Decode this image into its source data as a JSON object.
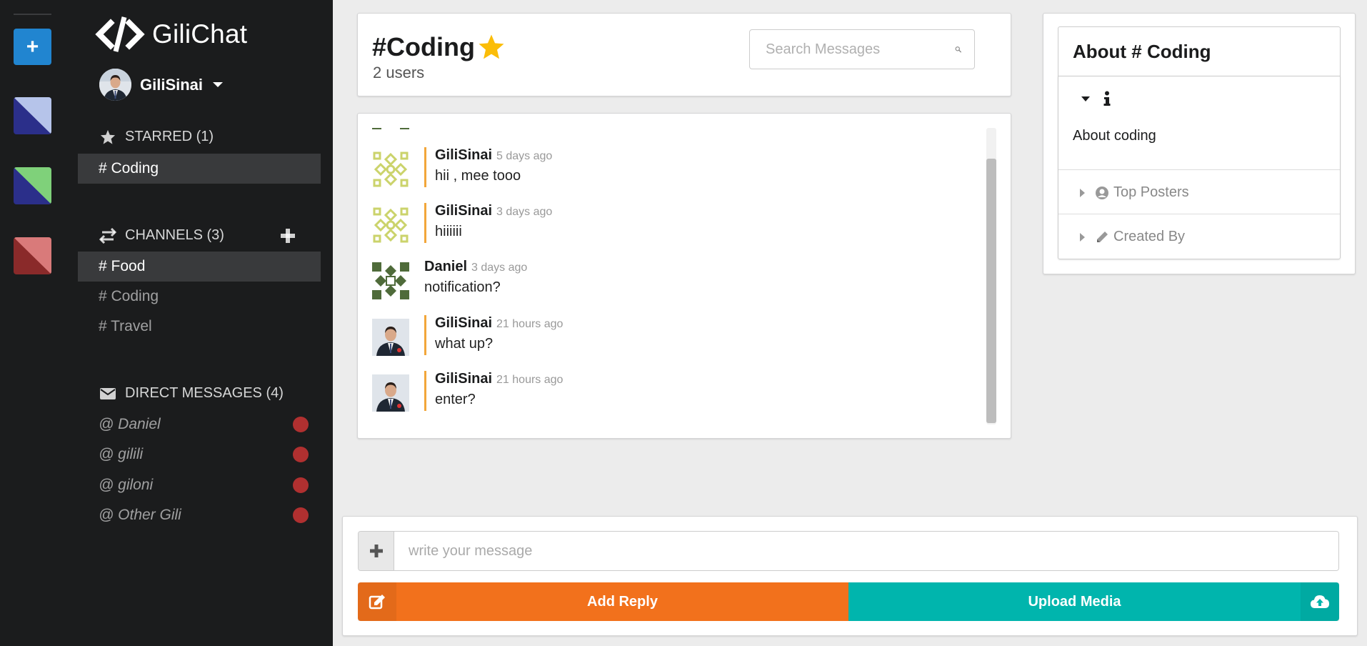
{
  "app": {
    "name": "GiliChat"
  },
  "user": {
    "name": "GiliSinai"
  },
  "sidebar": {
    "starred": {
      "title": "STARRED (1)",
      "items": [
        {
          "label": "# Coding"
        }
      ]
    },
    "channels": {
      "title": "CHANNELS (3)",
      "items": [
        {
          "label": "# Food"
        },
        {
          "label": "# Coding"
        },
        {
          "label": "# Travel"
        }
      ]
    },
    "direct": {
      "title": "DIRECT MESSAGES (4)",
      "items": [
        {
          "label": "@ Daniel"
        },
        {
          "label": "@ gilili"
        },
        {
          "label": "@ giloni"
        },
        {
          "label": "@ Other Gili"
        }
      ]
    }
  },
  "channel": {
    "title": "#Coding",
    "users": "2 users"
  },
  "search": {
    "placeholder": "Search Messages"
  },
  "messages": [
    {
      "author": "GiliSinai",
      "time": "5 days ago",
      "text": "hii , mee tooo"
    },
    {
      "author": "GiliSinai",
      "time": "3 days ago",
      "text": "hiiiiii"
    },
    {
      "author": "Daniel",
      "time": "3 days ago",
      "text": "notification?"
    },
    {
      "author": "GiliSinai",
      "time": "21 hours ago",
      "text": "what up?"
    },
    {
      "author": "GiliSinai",
      "time": "21 hours ago",
      "text": "enter?"
    }
  ],
  "about": {
    "title": "About # Coding",
    "description": "About coding",
    "top_posters": "Top Posters",
    "created_by": "Created By"
  },
  "compose": {
    "placeholder": "write your message",
    "reply_label": "Add Reply",
    "upload_label": "Upload Media"
  },
  "colors": {
    "reply": "#f2711c",
    "upload": "#00b5ad",
    "add": "#2185d0",
    "unread": "#b03030",
    "accent_border": "#f2a63a"
  }
}
